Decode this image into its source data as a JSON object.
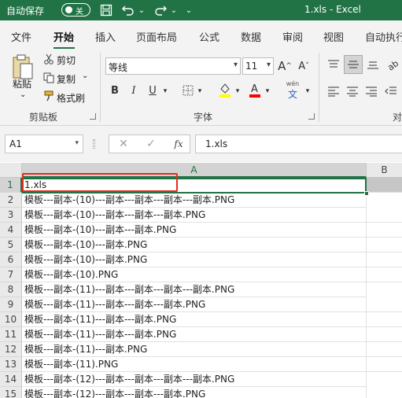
{
  "titlebar": {
    "autosave_label": "自动保存",
    "autosave_state": "关",
    "doc_title": "1.xls  -  Excel",
    "bg_color": "#217346"
  },
  "tabs": [
    "文件",
    "开始",
    "插入",
    "页面布局",
    "公式",
    "数据",
    "审阅",
    "视图",
    "自动执行"
  ],
  "active_tab": "开始",
  "ribbon": {
    "clipboard": {
      "paste": "粘贴",
      "cut": "剪切",
      "copy": "复制",
      "format_painter": "格式刷",
      "group_label": "剪贴板"
    },
    "font": {
      "font_name": "等线",
      "font_size": "11",
      "grow_font": "A^",
      "shrink_font": "A˅",
      "bold": "B",
      "italic": "I",
      "underline": "U",
      "group_label": "字体",
      "fill_color": "#ffff00",
      "font_color": "#ff0000",
      "phonetic": "wén"
    },
    "alignment": {
      "group_label": "对"
    }
  },
  "formula_bar": {
    "name_box": "A1",
    "fx": "fx",
    "formula_value": "1.xls"
  },
  "columns": [
    "A",
    "B"
  ],
  "rows": [
    {
      "num": "1",
      "a": "1.xls"
    },
    {
      "num": "2",
      "a": "模板---副本-(10)---副本---副本---副本---副本.PNG"
    },
    {
      "num": "3",
      "a": "模板---副本-(10)---副本---副本---副本.PNG"
    },
    {
      "num": "4",
      "a": "模板---副本-(10)---副本---副本.PNG"
    },
    {
      "num": "5",
      "a": "模板---副本-(10)---副本.PNG"
    },
    {
      "num": "6",
      "a": "模板---副本-(10)---副本.PNG"
    },
    {
      "num": "7",
      "a": "模板---副本-(10).PNG"
    },
    {
      "num": "8",
      "a": "模板---副本-(11)---副本---副本---副本---副本.PNG"
    },
    {
      "num": "9",
      "a": "模板---副本-(11)---副本---副本---副本.PNG"
    },
    {
      "num": "10",
      "a": "模板---副本-(11)---副本---副本.PNG"
    },
    {
      "num": "11",
      "a": "模板---副本-(11)---副本---副本.PNG"
    },
    {
      "num": "12",
      "a": "模板---副本-(11)---副本.PNG"
    },
    {
      "num": "13",
      "a": "模板---副本-(11).PNG"
    },
    {
      "num": "14",
      "a": "模板---副本-(12)---副本---副本---副本---副本.PNG"
    },
    {
      "num": "15",
      "a": "模板---副本-(12)---副本---副本---副本.PNG"
    }
  ],
  "selected_cell": "A1",
  "annotation_color": "#e8291c"
}
